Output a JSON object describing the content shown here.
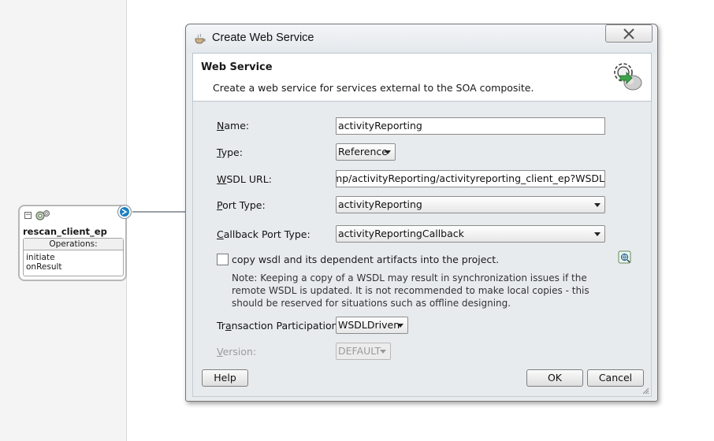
{
  "composite": {
    "component_title": "rescan_client_ep",
    "collapse_symbol": "−",
    "operations_header": "Operations:",
    "operations": [
      "initiate",
      "onResult"
    ]
  },
  "dialog": {
    "title": "Create Web Service",
    "close_symbol": "☒",
    "header": {
      "title": "Web Service",
      "description": "Create a web service for services external to the SOA composite."
    },
    "fields": {
      "name": {
        "mnemonic": "N",
        "rest": "ame:",
        "value": "activityReporting"
      },
      "type": {
        "mnemonic": "T",
        "rest": "ype:",
        "value": "Reference"
      },
      "wsdl_url": {
        "mnemonic": "W",
        "rest": "SDL URL:",
        "value": "es/temp/activityReporting/activityreporting_client_ep?WSDL"
      },
      "port_type": {
        "mnemonic": "P",
        "rest": "ort Type:",
        "value": "activityReporting"
      },
      "callback_port_type": {
        "mnemonic": "C",
        "rest": "allback Port Type:",
        "value": "activityReportingCallback"
      },
      "transaction_participation": {
        "pre": "Tr",
        "mnemonic": "a",
        "rest": "nsaction Participation:",
        "value": "WSDLDriven"
      },
      "version": {
        "mnemonic": "V",
        "rest": "ersion:",
        "value": "DEFAULT"
      }
    },
    "copy_wsdl": {
      "checked": false,
      "label": "copy wsdl and its dependent artifacts into the project."
    },
    "note": "Note: Keeping a copy of a WSDL may result in synchronization issues if the remote WSDL is updated. It is not recommended to make local copies - this should be reserved for situations such as offline designing.",
    "buttons": {
      "help": "Help",
      "ok": "OK",
      "cancel": "Cancel"
    }
  },
  "icons": [
    "collapse-icon",
    "gears-icon",
    "service-port-icon",
    "cup-icon",
    "close-icon",
    "web-service-gear-icon",
    "browse-wsdl-icon",
    "resize-grip-icon"
  ]
}
